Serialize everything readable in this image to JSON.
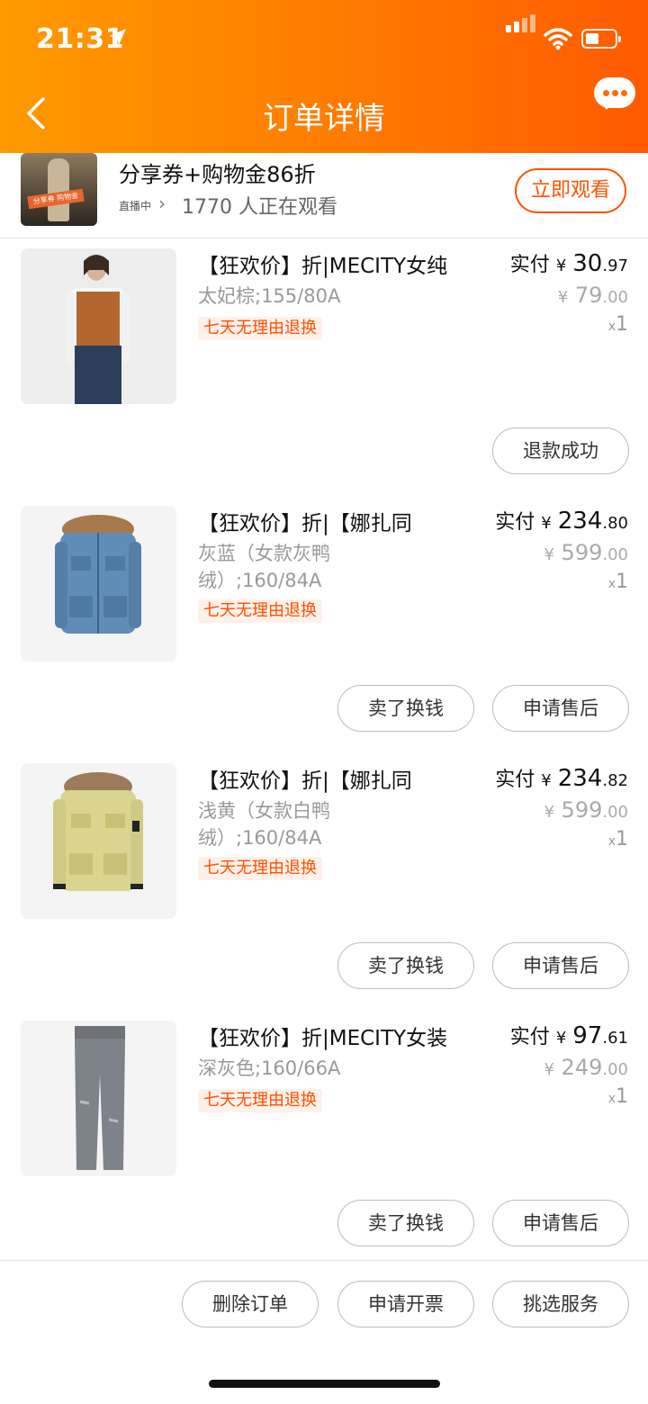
{
  "status_bar": {
    "time": "21:31"
  },
  "header": {
    "title": "订单详情",
    "back_icon": "chevron-left-icon",
    "message_icon": "chat-bubble-icon"
  },
  "live_banner": {
    "title": "分享券+购物金86折",
    "badge": "直播中",
    "viewers": "1770 人正在观看",
    "thumb_tag": "分享券 购物金",
    "watch_button": "立即观看"
  },
  "items": [
    {
      "title": "【狂欢价】折|MECITY女纯",
      "sku": "太妃棕;155/80A",
      "badge": "七天无理由退换",
      "paid_label": "实付",
      "currency": "¥",
      "paid_int": "30",
      "paid_dec": ".97",
      "orig_int": "79",
      "orig_dec": ".00",
      "qty_prefix": "x",
      "qty": "1",
      "buttons": [
        "退款成功"
      ]
    },
    {
      "title": "【狂欢价】折|【娜扎同",
      "sku": "灰蓝（女款灰鸭绒）;160/84A",
      "badge": "七天无理由退换",
      "paid_label": "实付",
      "currency": "¥",
      "paid_int": "234",
      "paid_dec": ".80",
      "orig_int": "599",
      "orig_dec": ".00",
      "qty_prefix": "x",
      "qty": "1",
      "buttons": [
        "卖了换钱",
        "申请售后"
      ]
    },
    {
      "title": "【狂欢价】折|【娜扎同",
      "sku": "浅黄（女款白鸭绒）;160/84A",
      "badge": "七天无理由退换",
      "paid_label": "实付",
      "currency": "¥",
      "paid_int": "234",
      "paid_dec": ".82",
      "orig_int": "599",
      "orig_dec": ".00",
      "qty_prefix": "x",
      "qty": "1",
      "buttons": [
        "卖了换钱",
        "申请售后"
      ]
    },
    {
      "title": "【狂欢价】折|MECITY女装",
      "sku": "深灰色;160/66A",
      "badge": "七天无理由退换",
      "paid_label": "实付",
      "currency": "¥",
      "paid_int": "97",
      "paid_dec": ".61",
      "orig_int": "249",
      "orig_dec": ".00",
      "qty_prefix": "x",
      "qty": "1",
      "buttons": [
        "卖了换钱",
        "申请售后"
      ]
    }
  ],
  "footer": {
    "buttons": [
      "删除订单",
      "申请开票",
      "挑选服务"
    ]
  },
  "colors": {
    "accent": "#ff5000",
    "header_start": "#ff9a00",
    "header_end": "#ff5a00"
  }
}
